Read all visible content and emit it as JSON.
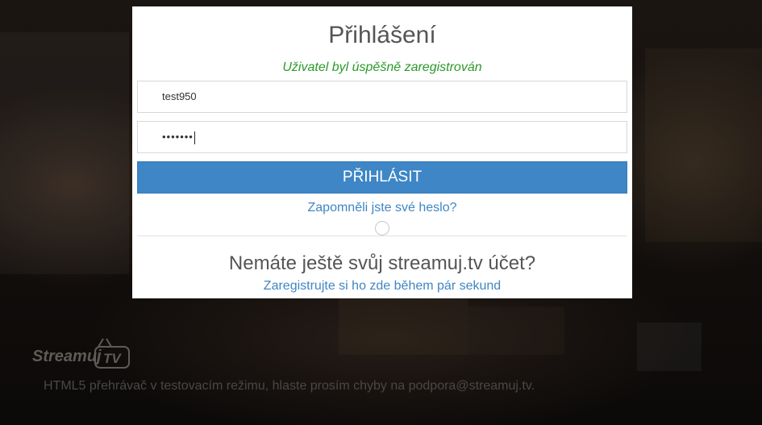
{
  "login": {
    "title": "Přihlášení",
    "success_message": "Uživatel byl úspěšně zaregistrován",
    "username_value": "test950",
    "password_mask": "•••••••",
    "submit_label": "PŘIHLÁSIT",
    "forgot_link": "Zapomněli jste své heslo?",
    "no_account_text": "Nemáte ještě svůj streamuj.tv účet?",
    "register_link": "Zaregistrujte si ho zde během pár sekund"
  },
  "footer": {
    "logo_text": "Streamuj",
    "logo_badge": "TV",
    "notice": "HTML5 přehrávač v testovacím režimu, hlaste prosím chyby na podpora@streamuj.tv."
  },
  "colors": {
    "accent": "#3e86c6",
    "link": "#3f86c4",
    "success": "#2a9a2a"
  }
}
